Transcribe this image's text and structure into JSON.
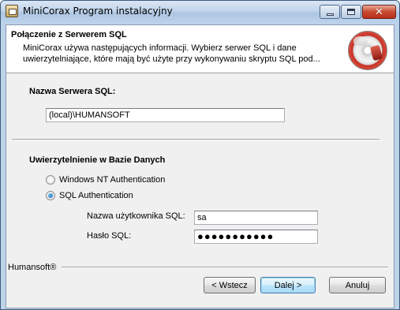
{
  "window": {
    "title": "MiniCorax Program instalacyjny",
    "icon": "installer-icon"
  },
  "banner": {
    "title": "Połączenie z Serwerem SQL",
    "description": "MiniCorax używa następujących informacji. Wybierz serwer SQL i dane uwierzytelniające, które mają być użyte przy wykonywaniu skryptu SQL pod..."
  },
  "server": {
    "label": "Nazwa Serwera SQL:",
    "value": "(local)\\HUMANSOFT"
  },
  "auth": {
    "label": "Uwierzytelnienie w Bazie Danych",
    "options": [
      {
        "label": "Windows NT Authentication",
        "selected": false
      },
      {
        "label": "SQL Authentication",
        "selected": true
      }
    ],
    "username_label": "Nazwa użytkownika SQL:",
    "username_value": "sa",
    "password_label": "Hasło SQL:",
    "password_value": "●●●●●●●●●●●"
  },
  "footer": {
    "brand": "Humansoft®",
    "back_label": "< Wstecz",
    "next_label": "Dalej >",
    "cancel_label": "Anuluj"
  }
}
